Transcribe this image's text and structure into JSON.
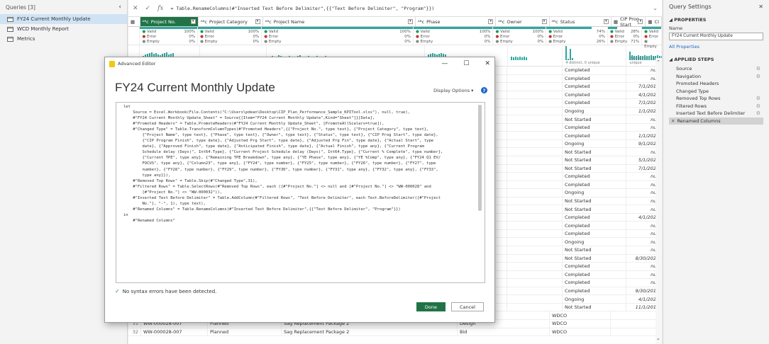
{
  "queries": {
    "header": "Queries [3]",
    "items": [
      {
        "label": "FY24 Current Monthly Update",
        "selected": true
      },
      {
        "label": "WCD Monthly Report",
        "selected": false
      },
      {
        "label": "Metrics",
        "selected": false
      }
    ]
  },
  "formula_bar": {
    "fx": "fx",
    "formula": "= Table.RenameColumns(#\"Inserted Text Before Delimiter\",{{\"Text Before Delimiter\", \"Program\"}})"
  },
  "grid": {
    "columns": [
      {
        "label": "Project No.",
        "type": "ABC",
        "valid": "100%",
        "error": "0%",
        "empty": "0%"
      },
      {
        "label": "Project Category",
        "type": "ABC",
        "valid": "100%",
        "error": "0%",
        "empty": "0%"
      },
      {
        "label": "Project Name",
        "type": "ABC",
        "valid": "100%",
        "error": "0%",
        "empty": "0%"
      },
      {
        "label": "Phase",
        "type": "ABC",
        "valid": "100%",
        "error": "0%",
        "empty": "0%"
      },
      {
        "label": "Owner",
        "type": "ABC",
        "valid": "100%",
        "error": "0%",
        "empty": "0%"
      },
      {
        "label": "Status",
        "type": "ABC",
        "valid": "74%",
        "error": "0%",
        "empty": "26%"
      },
      {
        "label": "CIP Prog Start",
        "type": "date",
        "valid": "28%",
        "error": "0%",
        "empty": "71%"
      },
      {
        "label": "CI",
        "type": "date",
        "valid": "Val",
        "error": "Err",
        "empty": "Em"
      }
    ],
    "profile_labels": {
      "valid": "Valid",
      "error": "Error",
      "empty": "Empty"
    },
    "distinct": [
      "4 distinct, 0 unique",
      "21 distinct, 16 unique",
      "24 dis"
    ],
    "status_col": [
      "Completed",
      "Completed",
      "Completed",
      "Completed",
      "Completed",
      "Ongoing",
      "Not Started",
      "Completed",
      "Completed",
      "Ongoing",
      "Not Started",
      "Not Started",
      "Not Started",
      "Completed",
      "Completed",
      "Ongoing",
      "Not Started",
      "Not Started",
      "Completed",
      "Completed",
      "Completed",
      "Ongoing",
      "Not Started",
      "Not Started",
      "Completed",
      "Completed",
      "Completed",
      "Completed",
      "Ongoing",
      "Not Started"
    ],
    "date_col": [
      "null",
      "null",
      "7/1/2019",
      "4/1/2020",
      "7/1/2021",
      "1/1/2022",
      "null",
      "null",
      "1/1/2020",
      "9/1/2020",
      "null",
      "5/1/2022",
      "7/1/2023",
      "null",
      "null",
      "null",
      "null",
      "null",
      "4/1/2023",
      "null",
      "null",
      "null",
      "null",
      "8/30/2022",
      "null",
      "null",
      "null",
      "9/30/2019",
      "4/1/2020",
      "11/1/2019"
    ],
    "bottom_rows": [
      {
        "n": "30",
        "no": "WW-000028-007",
        "cat": "Planned",
        "name": "Sag Replacement Package 2",
        "phase": "PER",
        "owner": "WDCO"
      },
      {
        "n": "31",
        "no": "WW-000028-007",
        "cat": "Planned",
        "name": "Sag Replacement Package 2",
        "phase": "Design",
        "owner": "WDCO"
      },
      {
        "n": "32",
        "no": "WW-000028-007",
        "cat": "Planned",
        "name": "Sag Replacement Package 2",
        "phase": "Bid",
        "owner": "WDCO"
      }
    ]
  },
  "settings": {
    "title": "Query Settings",
    "properties_label": "PROPERTIES",
    "name_label": "Name",
    "name_value": "FY24 Current Monthly Update",
    "all_properties": "All Properties",
    "applied_steps_label": "APPLIED STEPS",
    "steps": [
      {
        "label": "Source",
        "gear": true,
        "selected": false
      },
      {
        "label": "Navigation",
        "gear": true,
        "selected": false
      },
      {
        "label": "Promoted Headers",
        "gear": false,
        "selected": false
      },
      {
        "label": "Changed Type",
        "gear": false,
        "selected": false
      },
      {
        "label": "Removed Top Rows",
        "gear": true,
        "selected": false
      },
      {
        "label": "Filtered Rows",
        "gear": true,
        "selected": false
      },
      {
        "label": "Inserted Text Before Delimiter",
        "gear": true,
        "selected": false
      },
      {
        "label": "Renamed Columns",
        "gear": false,
        "selected": true
      }
    ]
  },
  "editor": {
    "window_title": "Advanced Editor",
    "heading": "FY24 Current Monthly Update",
    "display_options": "Display Options ▾",
    "code": "let\n    Source = Excel.Workbook(File.Contents(\"C:\\Users\\pdean\\Desktop\\CIP_Plan_Performance_Sample_KPITool.xlsx\"), null, true),\n    #\"FY24 Current Monthly Update_Sheet\" = Source{[Item=\"FY24 Current Monthly Update\",Kind=\"Sheet\"]}[Data],\n    #\"Promoted Headers\" = Table.PromoteHeaders(#\"FY24 Current Monthly Update_Sheet\", [PromoteAllScalars=true]),\n    #\"Changed Type\" = Table.TransformColumnTypes(#\"Promoted Headers\",{{\"Project No.\", type text}, {\"Project Category\", type text},\n        {\"Project Name\", type text}, {\"Phase\", type text}, {\"Owner\", type text}, {\"Status\", type text}, {\"CIP Prog Start\", type date},\n        {\"CIP Program Finish\", type date}, {\"Adjusted Prg Start\", type date}, {\"Adjusted Prg Fin\", type date}, {\"Actual Start\", type\n        date}, {\"Approved Finish\", type date}, {\"Anticipated Finish\", type date}, {\"Actual Finish\", type any}, {\"Current Program\n        Schedule delay (Days)\", Int64.Type}, {\"Current Project Schedule delay (Days)\", Int64.Type}, {\"Current % Complete\", type number},\n        {\"Current TPE\", type any}, {\"Remaining TPE Breakdown\", type any}, {\"YE Phase\", type any}, {\"YE %Comp\", type any}, {\"FY24 Q1 EV/\n        FOCUS\", type any}, {\"Column23\", type any}, {\"FY24\", type number}, {\"FY25\", type number}, {\"FY26\", type number}, {\"FY27\", type\n        number}, {\"FY28\", type number}, {\"FY29\", type number}, {\"FY30\", type number}, {\"FY31\", type any}, {\"FY32\", type any}, {\"FY33\",\n        type any}}),\n    #\"Removed Top Rows\" = Table.Skip(#\"Changed Type\",31),\n    #\"Filtered Rows\" = Table.SelectRows(#\"Removed Top Rows\", each ([#\"Project No.\"] <> null and [#\"Project No.\"] <> \"WW-000028\" and\n        [#\"Project No.\"] <> \"WW-000032\")),\n    #\"Inserted Text Before Delimiter\" = Table.AddColumn(#\"Filtered Rows\", \"Text Before Delimiter\", each Text.BeforeDelimiter([#\"Project\n        No.\"], \"-\", 1), type text),\n    #\"Renamed Columns\" = Table.RenameColumns(#\"Inserted Text Before Delimiter\",{{\"Text Before Delimiter\", \"Program\"}})\nin\n    #\"Renamed Columns\"",
    "status": "No syntax errors have been detected.",
    "done": "Done",
    "cancel": "Cancel"
  }
}
